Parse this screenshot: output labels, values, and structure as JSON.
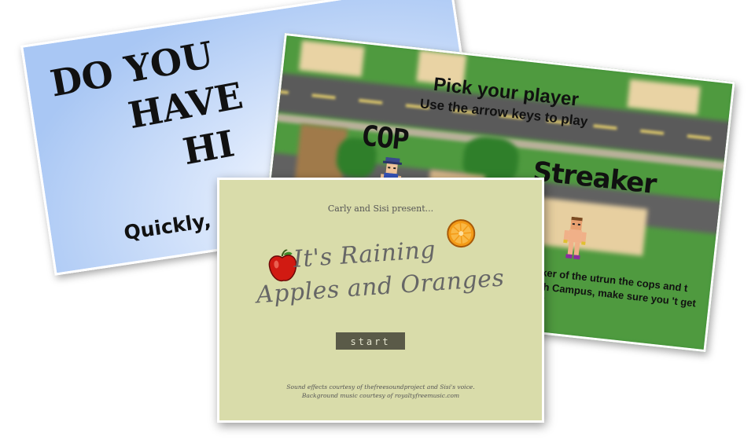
{
  "blue_card": {
    "title_lines": [
      "DO YOU",
      "HAVE",
      "HI"
    ],
    "subtitle": "Quickly, clic"
  },
  "player_card": {
    "title": "Pick your player",
    "instructions": "Use the arrow keys to play",
    "cop_label": "COP",
    "streaker_label": "Streaker",
    "streaker_description": "a breaker of the utrun the cops and t to North Campus, make sure you 't get caught!"
  },
  "apples_card": {
    "presenter": "Carly and Sisi present...",
    "title_line1": "It's Raining",
    "title_line2": "Apples and Oranges",
    "start_label": "start",
    "credits_line1": "Sound effects courtesy of thefreesoundproject and Sisi's voice.",
    "credits_line2": "Background music courtesy of royaltyfreemusic.com"
  },
  "icons": {
    "apple": "apple-icon",
    "orange": "orange-icon",
    "cop_sprite": "cop-sprite-icon",
    "streaker_sprite": "streaker-sprite-icon"
  },
  "colors": {
    "blue_card_bg": "#a9c7f4",
    "game_grass": "#4f9a3f",
    "apples_card_bg": "#d9dcaa",
    "start_button_bg": "#5a5a48",
    "apple_red": "#d11a12",
    "orange": "#f39a16"
  }
}
